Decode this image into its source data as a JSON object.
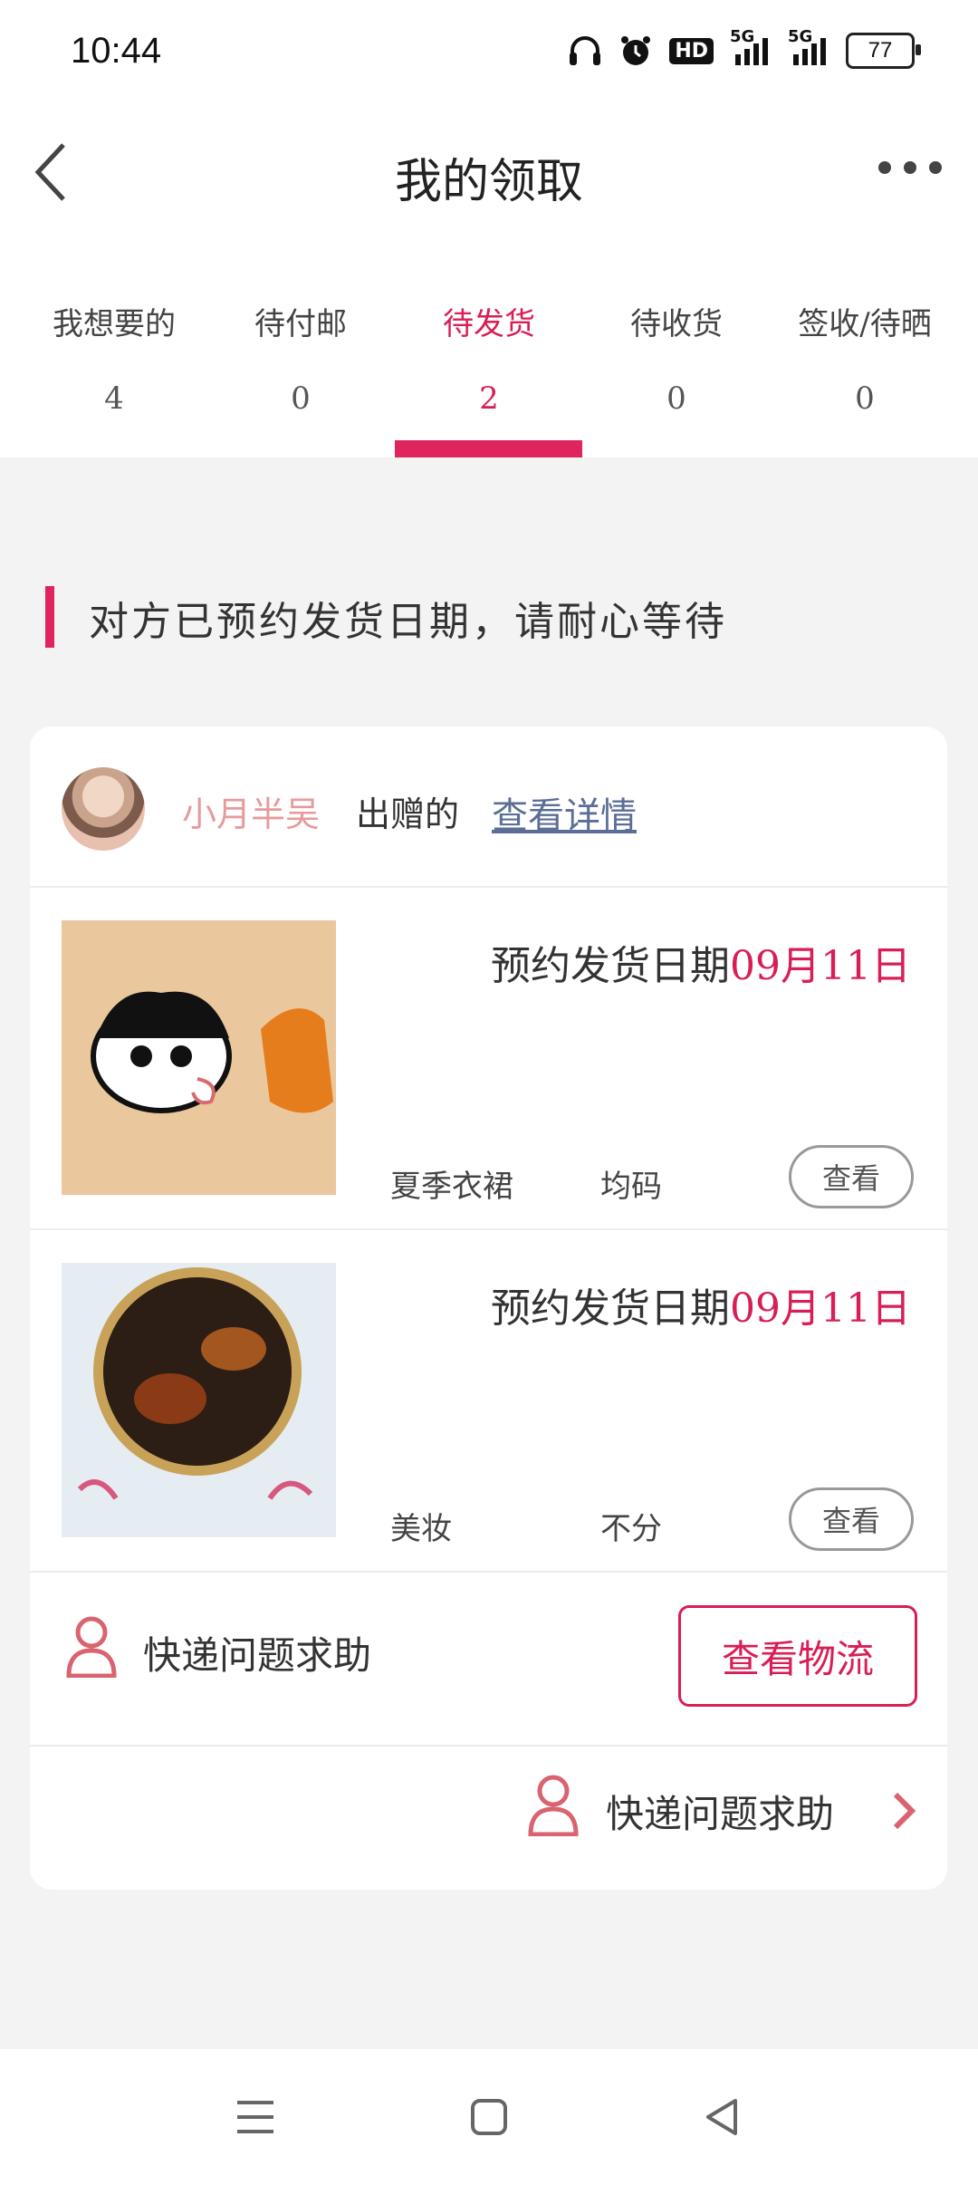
{
  "status_bar": {
    "time": "10:44",
    "battery": "77",
    "icons": [
      "headphones-icon",
      "alarm-icon",
      "hd-icon",
      "signal-5g-icon",
      "signal-5g-icon",
      "battery-icon"
    ],
    "hd_label": "HD",
    "net1": "5G",
    "net2": "5G"
  },
  "header": {
    "title": "我的领取"
  },
  "tabs": [
    {
      "label": "我想要的",
      "count": "4"
    },
    {
      "label": "待付邮",
      "count": "0"
    },
    {
      "label": "待发货",
      "count": "2",
      "active": true
    },
    {
      "label": "待收货",
      "count": "0"
    },
    {
      "label": "签收/待晒",
      "count": "0"
    }
  ],
  "notice": "对方已预约发货日期，请耐心等待",
  "card": {
    "donor_name": "小月半吴",
    "donated_label": "出赠的",
    "detail_link": "查看详情",
    "items": [
      {
        "ship_label": "预约发货日期",
        "ship_date": "09月11日",
        "category": "夏季衣裙",
        "size": "均码",
        "view_label": "查看"
      },
      {
        "ship_label": "预约发货日期",
        "ship_date": "09月11日",
        "category": "美妆",
        "size": "不分",
        "view_label": "查看"
      }
    ],
    "help_label": "快递问题求助",
    "logistics_label": "查看物流",
    "help_label_2": "快递问题求助"
  },
  "colors": {
    "accent": "#e0245e",
    "link": "#5b6e96",
    "donor": "#e89a9a"
  }
}
